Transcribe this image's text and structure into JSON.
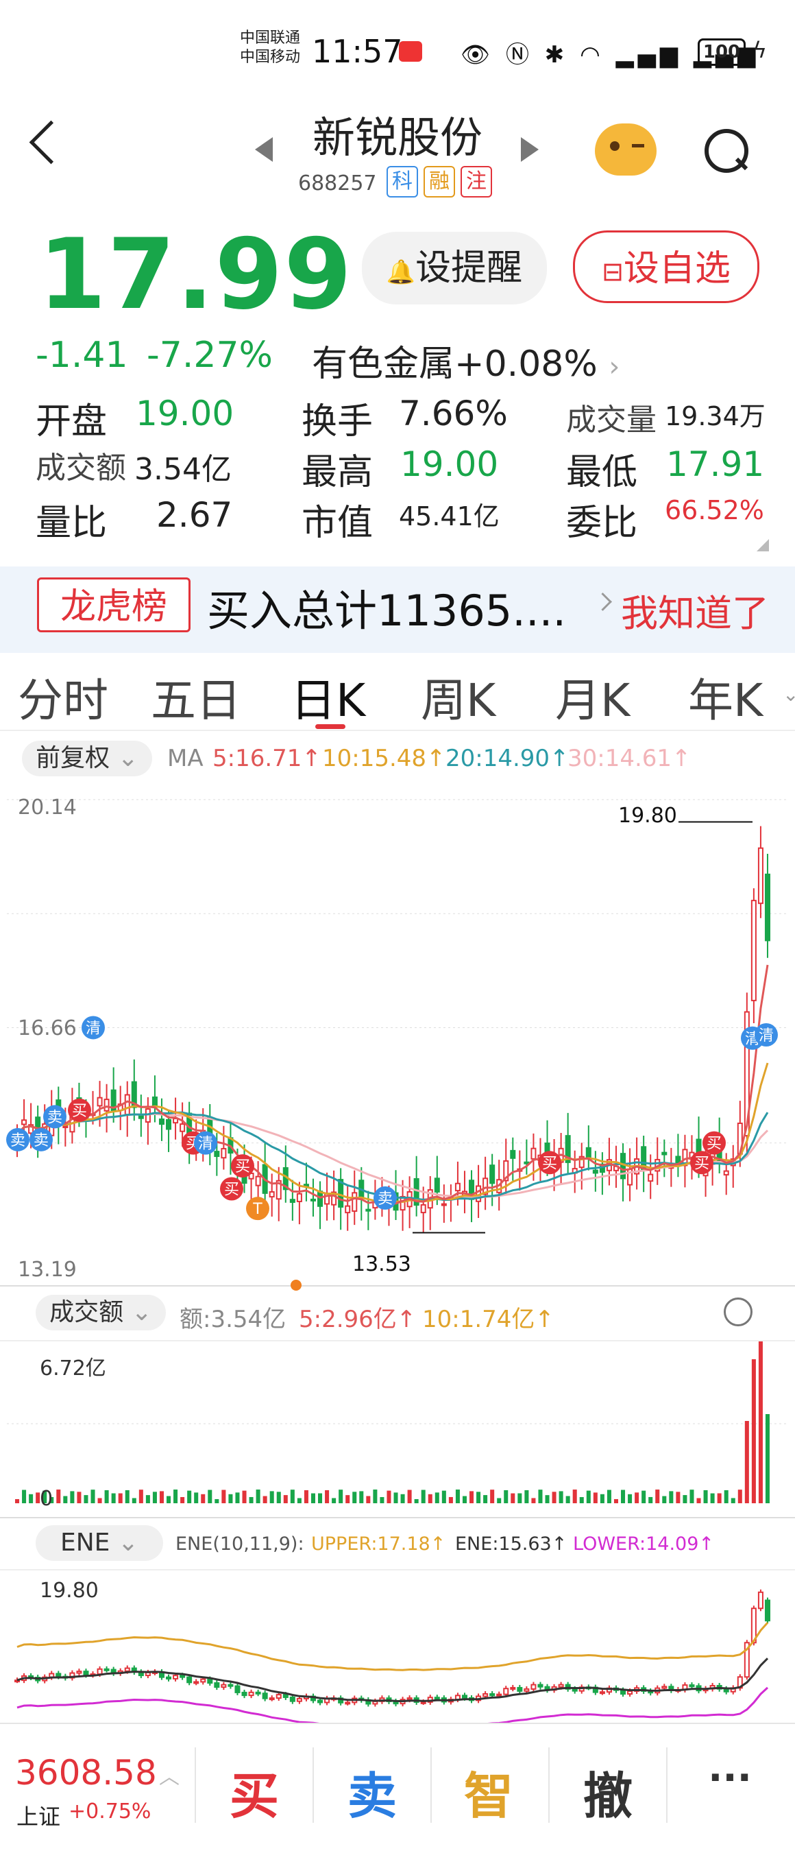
{
  "status_bar": {
    "carrier1": "中国联通",
    "carrier2": "中国移动",
    "time": "11:57",
    "battery": "100",
    "icons": [
      "eye-icon",
      "nfc-icon",
      "bluetooth-icon",
      "wifi-icon",
      "5g-signal-icon",
      "4g-signal-icon",
      "charging-icon"
    ]
  },
  "header": {
    "name": "新锐股份",
    "code": "688257",
    "tags": [
      "科",
      "融",
      "注"
    ],
    "tag_colors": [
      "#3a8ee6",
      "#e39a1c",
      "#e2333a"
    ]
  },
  "quote": {
    "price": "17.99",
    "change": "-1.41",
    "change_pct": "-7.27%",
    "sector": "有色金属",
    "sector_chg": "+0.08%",
    "remind_btn": "设提醒",
    "fav_btn": "设自选",
    "fields": {
      "open_label": "开盘",
      "open": "19.00",
      "turnover_label": "换手",
      "turnover": "7.66%",
      "volume_label": "成交量",
      "volume": "19.34万",
      "amount_label": "成交额",
      "amount": "3.54亿",
      "high_label": "最高",
      "high": "19.00",
      "low_label": "最低",
      "low": "17.91",
      "vol_ratio_label": "量比",
      "vol_ratio": "2.67",
      "mktcap_label": "市值",
      "mktcap": "45.41亿",
      "bid_ratio_label": "委比",
      "bid_ratio": "66.52%"
    }
  },
  "banner": {
    "tag": "龙虎榜",
    "text": "买入总计11365....",
    "dismiss": "我知道了"
  },
  "tabs": [
    "分时",
    "五日",
    "日K",
    "周K",
    "月K",
    "年K"
  ],
  "chart_header": {
    "adjust": "前复权",
    "ma_label": "MA",
    "ma5": "5:16.71↑",
    "ma10": "10:15.48↑",
    "ma20": "20:14.90↑",
    "ma30": "30:14.61↑",
    "colors": {
      "ma5": "#e05757",
      "ma10": "#e0a32b",
      "ma20": "#2a9aa6",
      "ma30": "#f2b3b8",
      "up": "#e2333a",
      "down": "#18a64a"
    }
  },
  "kline": {
    "y_top": "20.14",
    "y_mid": "16.66",
    "y_bottom": "13.19",
    "max_label": "19.80",
    "min_label": "13.53",
    "markers": {
      "buy": "买",
      "sell": "卖",
      "clear": "清",
      "t": "T"
    }
  },
  "volume_panel": {
    "indicator": "成交额",
    "amount": "额:3.54亿",
    "ma5": "5:2.96亿↑",
    "ma10": "10:1.74亿↑",
    "y_top": "6.72亿",
    "y_bottom": "0"
  },
  "ene_panel": {
    "indicator": "ENE",
    "params": "ENE(10,11,9):",
    "upper": "UPPER:17.18↑",
    "ene": "ENE:15.63↑",
    "lower": "LOWER:14.09↑",
    "y_top": "19.80",
    "colors": {
      "upper": "#e0a32b",
      "ene": "#333333",
      "lower": "#d22bd2"
    }
  },
  "bottom": {
    "index_value": "3608.58",
    "index_name": "上证",
    "index_chg": "+0.75%",
    "actions": [
      "买",
      "卖",
      "智",
      "撤",
      "···"
    ],
    "action_colors": [
      "#e2333a",
      "#2a7de1",
      "#e0a32b",
      "#333333",
      "#333333"
    ]
  },
  "chart_data": {
    "type": "candlestick",
    "title": "",
    "ylim": [
      13.19,
      20.14
    ],
    "high": 19.8,
    "low": 13.53,
    "last": {
      "open": 19.0,
      "high": 19.0,
      "low": 17.91,
      "close": 17.99
    }
  }
}
